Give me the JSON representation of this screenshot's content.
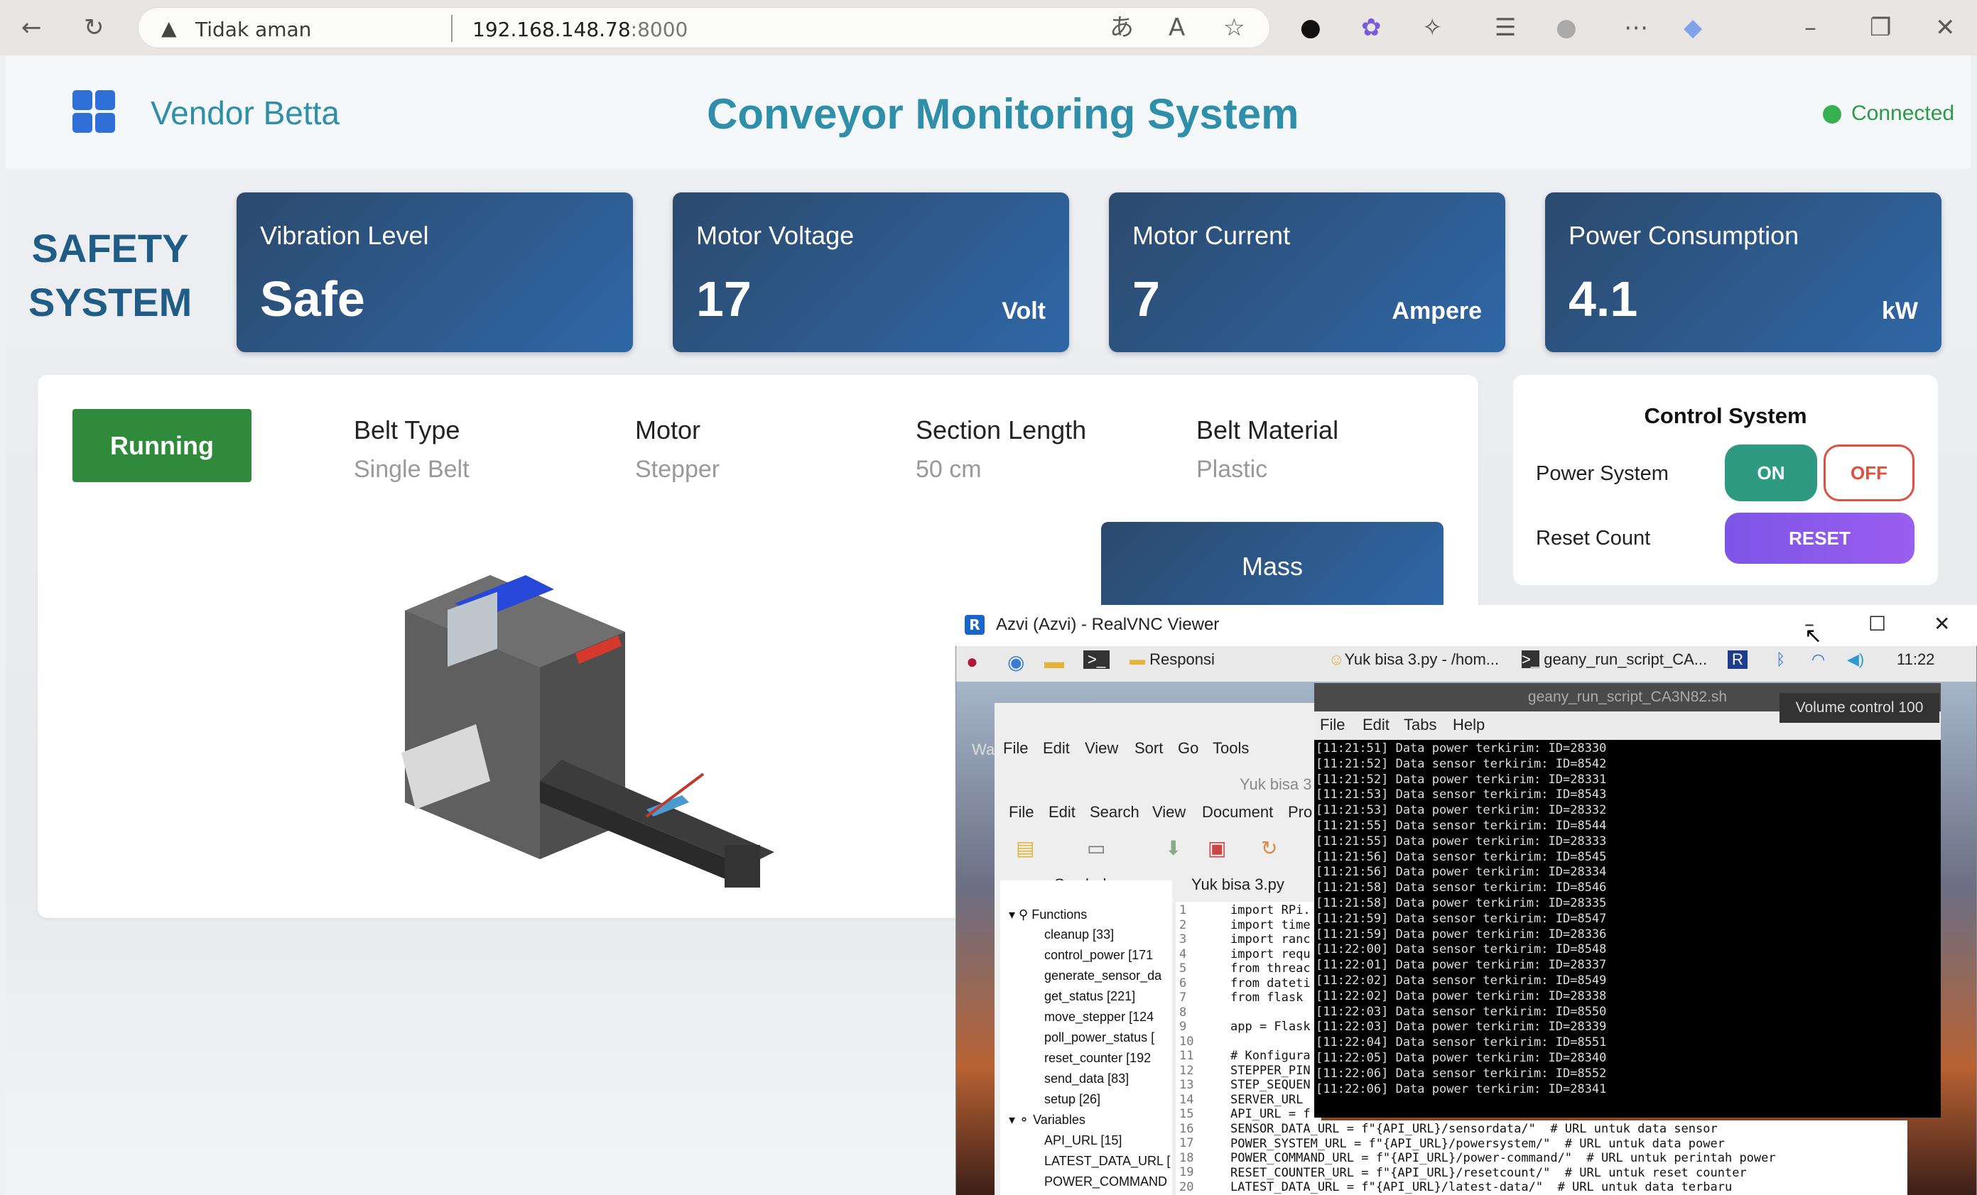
{
  "browser": {
    "security_label": "Tidak aman",
    "url_host": "192.168.148.78",
    "url_port": ":8000"
  },
  "header": {
    "brand": "Vendor Betta",
    "title": "Conveyor Monitoring System",
    "status": "Connected"
  },
  "safety_title_1": "SAFETY",
  "safety_title_2": "SYSTEM",
  "cards": [
    {
      "label": "Vibration Level",
      "value": "Safe",
      "unit": ""
    },
    {
      "label": "Motor Voltage",
      "value": "17",
      "unit": "Volt"
    },
    {
      "label": "Motor Current",
      "value": "7",
      "unit": "Ampere"
    },
    {
      "label": "Power Consumption",
      "value": "4.1",
      "unit": "kW"
    }
  ],
  "status_button": "Running",
  "specs": [
    {
      "label": "Belt Type",
      "value": "Single Belt"
    },
    {
      "label": "Motor",
      "value": "Stepper"
    },
    {
      "label": "Section Length",
      "value": "50 cm"
    },
    {
      "label": "Belt Material",
      "value": "Plastic"
    }
  ],
  "mass_label": "Mass",
  "control": {
    "title": "Control System",
    "power_label": "Power System",
    "on": "ON",
    "off": "OFF",
    "reset_label": "Reset Count",
    "reset": "RESET"
  },
  "vnc": {
    "title": "Azvi (Azvi) - RealVNC Viewer",
    "task_folder": "Responsi",
    "task_geany": "Yuk bisa 3.py - /hom...",
    "task_term": "geany_run_script_CA...",
    "clock": "11:22",
    "tooltip": "Volume control 100",
    "wa": "Wa",
    "fm_menu": [
      "File",
      "Edit",
      "View",
      "Sort",
      "Go",
      "Tools"
    ],
    "fm_window_title": "Yuk bisa 3",
    "geany_menu": [
      "File",
      "Edit",
      "Search",
      "View",
      "Document",
      "Pro"
    ],
    "tab_symbols": "Symbols",
    "tab_file": "Yuk bisa 3.py",
    "functions_label": "Functions",
    "functions": [
      "cleanup [33]",
      "control_power [171",
      "generate_sensor_da",
      "get_status [221]",
      "move_stepper [124",
      "poll_power_status [",
      "reset_counter [192",
      "send_data [83]",
      "setup [26]"
    ],
    "variables_label": "Variables",
    "variables": [
      "API_URL [15]",
      "LATEST_DATA_URL [",
      "POWER_COMMAND"
    ],
    "line_numbers": "1\n2\n3\n4\n5\n6\n7\n8\n9\n10\n11\n12\n13\n14\n15\n16\n17\n18\n19\n20",
    "code_top": "import RPi.\nimport time\nimport ranc\nimport requ\nfrom threac\nfrom dateti\nfrom flask\n\napp = Flask\n\n# Konfigura\nSTEPPER_PIN\nSTEP_SEQUEN\nSERVER_URL\nAPI_URL = f",
    "code_bottom": "SENSOR_DATA_URL = f\"{API_URL}/sensordata/\"  # URL untuk data sensor\nPOWER_SYSTEM_URL = f\"{API_URL}/powersystem/\"  # URL untuk data power\nPOWER_COMMAND_URL = f\"{API_URL}/power-command/\"  # URL untuk perintah power\nRESET_COUNTER_URL = f\"{API_URL}/resetcount/\"  # URL untuk reset counter\nLATEST_DATA_URL = f\"{API_URL}/latest-data/\"  # URL untuk data terbaru",
    "terminal_title": "geany_run_script_CA3N82.sh",
    "terminal_menu": [
      "File",
      "Edit",
      "Tabs",
      "Help"
    ],
    "terminal_lines": "[11:21:51] Data power terkirim: ID=28330\n[11:21:52] Data sensor terkirim: ID=8542\n[11:21:52] Data power terkirim: ID=28331\n[11:21:53] Data sensor terkirim: ID=8543\n[11:21:53] Data power terkirim: ID=28332\n[11:21:55] Data sensor terkirim: ID=8544\n[11:21:55] Data power terkirim: ID=28333\n[11:21:56] Data sensor terkirim: ID=8545\n[11:21:56] Data power terkirim: ID=28334\n[11:21:58] Data sensor terkirim: ID=8546\n[11:21:58] Data power terkirim: ID=28335\n[11:21:59] Data sensor terkirim: ID=8547\n[11:21:59] Data power terkirim: ID=28336\n[11:22:00] Data sensor terkirim: ID=8548\n[11:22:01] Data power terkirim: ID=28337\n[11:22:02] Data sensor terkirim: ID=8549\n[11:22:02] Data power terkirim: ID=28338\n[11:22:03] Data sensor terkirim: ID=8550\n[11:22:03] Data power terkirim: ID=28339\n[11:22:04] Data sensor terkirim: ID=8551\n[11:22:05] Data power terkirim: ID=28340\n[11:22:06] Data sensor terkirim: ID=8552\n[11:22:06] Data power terkirim: ID=28341"
  },
  "colors": {
    "accent": "#2f8fa8",
    "card": "#2f67a7",
    "running": "#2f8a3b",
    "on": "#2e9a82",
    "off": "#e05040",
    "reset": "#8a5aec"
  }
}
